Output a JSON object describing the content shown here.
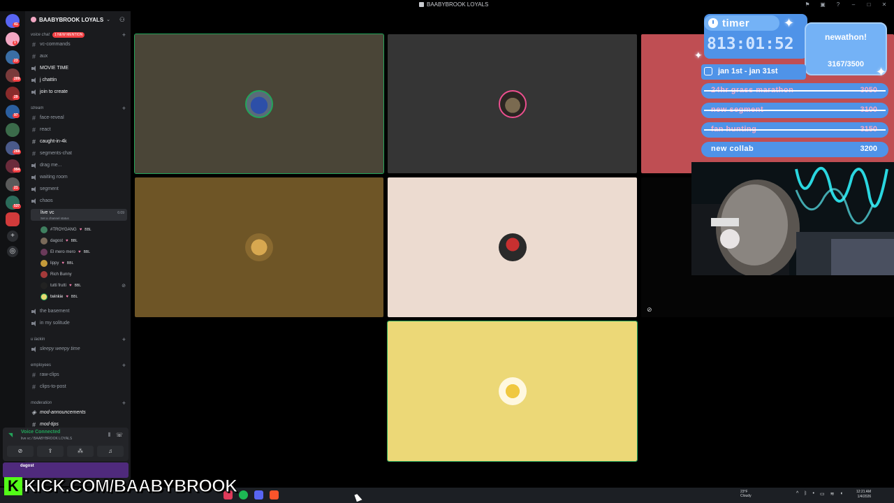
{
  "window": {
    "title": "BAABYBROOK LOYALS"
  },
  "server": {
    "name": "BAABYBROOK LOYALS"
  },
  "categories": {
    "voice_chat": "voice chat",
    "stream": "stream",
    "u_lackin": "u lackin",
    "employees": "employees",
    "moderation": "moderation"
  },
  "mention_badge": "1 NEW MENTION",
  "channels": {
    "vc_commands": "vc-commands",
    "aux": "aux",
    "movie_time": "MOVIE TIME",
    "j_chattin": "j chattin",
    "join_to_create": "join to create",
    "face_reveal": "face-reveal",
    "react": "react",
    "caught_in_4k": "caught-in-4k",
    "segments_chat": "segments-chat",
    "drag_me": "drag me...",
    "waiting_room": "waiting room",
    "segment": "segment",
    "chaos": "chaos",
    "live_vc": "live vc",
    "live_vc_status": "Set a channel status",
    "live_vc_time": "6:09",
    "the_basement": "the basement",
    "in_my_solitude": "in my solitude",
    "sleepy_weepy_time": "sleepy weepy time",
    "raw_clips": "raw-clips",
    "clips_to_post": "clips-to-post",
    "mod_announcements": "mod-announcements",
    "mod_tips": "mod-tips"
  },
  "vc_users": [
    {
      "name": "#TROYGANG",
      "tag": "BBL"
    },
    {
      "name": "dagost",
      "tag": "BBL"
    },
    {
      "name": "El mero mero",
      "tag": "BBL"
    },
    {
      "name": "lippy",
      "tag": "BBL"
    },
    {
      "name": "Rich Bunny",
      "tag": ""
    },
    {
      "name": "tutti frutti",
      "tag": "BBL"
    },
    {
      "name": "twinkie",
      "tag": "BBL"
    }
  ],
  "server_badges": [
    "41",
    "1",
    "23",
    "209",
    "29",
    "97",
    "268",
    "994",
    "21",
    "537"
  ],
  "voice_panel": {
    "status": "Voice Connected",
    "location": "live vc / BAABYBROOK LOYALS"
  },
  "user_panel": {
    "name": "dagost"
  },
  "kick": {
    "letter": "K",
    "url": "KICK.COM/BAABYBROOK"
  },
  "overlay": {
    "timer_label": "timer",
    "timer_value": "813:01:52",
    "subathon_label": "newathon!",
    "subathon_progress": "3167/3500",
    "date_range": "jan 1st - jan 31st",
    "goals": [
      {
        "name": "24hr grass marathon",
        "value": "3050",
        "done": true
      },
      {
        "name": "new segment",
        "value": "3100",
        "done": true
      },
      {
        "name": "fan hunting",
        "value": "3150",
        "done": true
      },
      {
        "name": "new collab",
        "value": "3200",
        "done": false
      }
    ]
  },
  "taskbar": {
    "weather_temp": "23°F",
    "weather_desc": "Cloudy",
    "time": "12:21 AM",
    "date": "1/4/2026"
  },
  "colors": {
    "speaking_outline": "#23a55a",
    "overlay_blue": "#4f93e8",
    "kick_green": "#53fc18"
  }
}
